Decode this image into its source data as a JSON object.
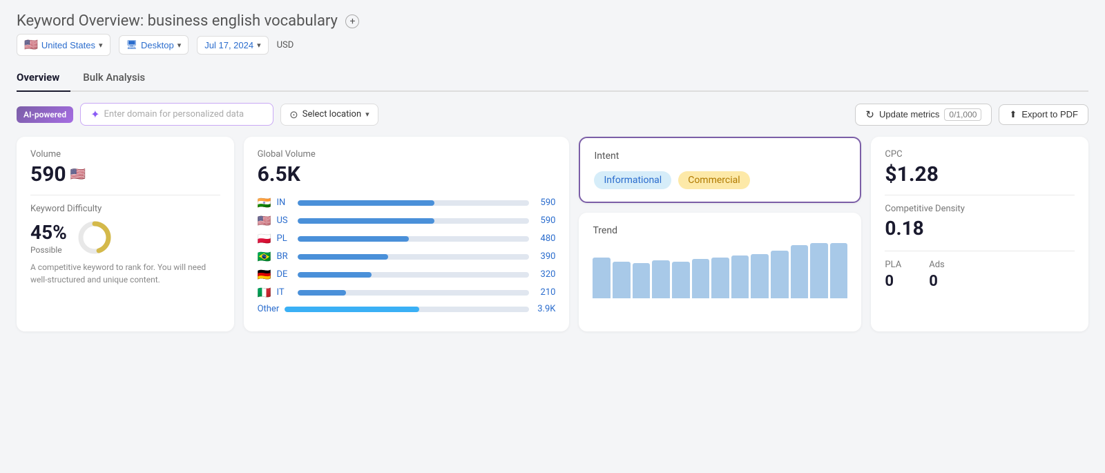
{
  "header": {
    "title_prefix": "Keyword Overview:",
    "title_keyword": "business english vocabulary",
    "add_icon": "+",
    "location": "United States",
    "location_flag": "🇺🇸",
    "device": "Desktop",
    "date": "Jul 17, 2024",
    "currency": "USD"
  },
  "tabs": [
    {
      "id": "overview",
      "label": "Overview",
      "active": true
    },
    {
      "id": "bulk",
      "label": "Bulk Analysis",
      "active": false
    }
  ],
  "toolbar": {
    "ai_badge": "AI-powered",
    "domain_placeholder": "Enter domain for personalized data",
    "location_placeholder": "Select location",
    "update_metrics_label": "Update metrics",
    "update_count": "0/1,000",
    "export_label": "Export to PDF"
  },
  "cards": {
    "volume": {
      "label": "Volume",
      "value": "590",
      "flag": "🇺🇸"
    },
    "kd": {
      "label": "Keyword Difficulty",
      "value": "45%",
      "possible": "Possible",
      "percent": 45,
      "description": "A competitive keyword to rank for. You will need well-structured and unique content."
    },
    "global_volume": {
      "label": "Global Volume",
      "value": "6.5K",
      "countries": [
        {
          "flag": "🇮🇳",
          "code": "IN",
          "bar_pct": 59,
          "val": "590"
        },
        {
          "flag": "🇺🇸",
          "code": "US",
          "bar_pct": 59,
          "val": "590"
        },
        {
          "flag": "🇵🇱",
          "code": "PL",
          "bar_pct": 48,
          "val": "480"
        },
        {
          "flag": "🇧🇷",
          "code": "BR",
          "bar_pct": 39,
          "val": "390"
        },
        {
          "flag": "🇩🇪",
          "code": "DE",
          "bar_pct": 32,
          "val": "320"
        },
        {
          "flag": "🇮🇹",
          "code": "IT",
          "bar_pct": 21,
          "val": "210"
        }
      ],
      "other_label": "Other",
      "other_bar_pct": 55,
      "other_val": "3.9K"
    },
    "intent": {
      "label": "Intent",
      "badges": [
        {
          "type": "info",
          "label": "Informational"
        },
        {
          "type": "commercial",
          "label": "Commercial"
        }
      ]
    },
    "trend": {
      "label": "Trend",
      "bars": [
        55,
        50,
        48,
        52,
        50,
        53,
        55,
        58,
        60,
        65,
        72,
        75,
        75
      ]
    },
    "cpc": {
      "label": "CPC",
      "value": "$1.28"
    },
    "competitive_density": {
      "label": "Competitive Density",
      "value": "0.18"
    },
    "pla": {
      "label": "PLA",
      "value": "0"
    },
    "ads": {
      "label": "Ads",
      "value": "0"
    }
  }
}
